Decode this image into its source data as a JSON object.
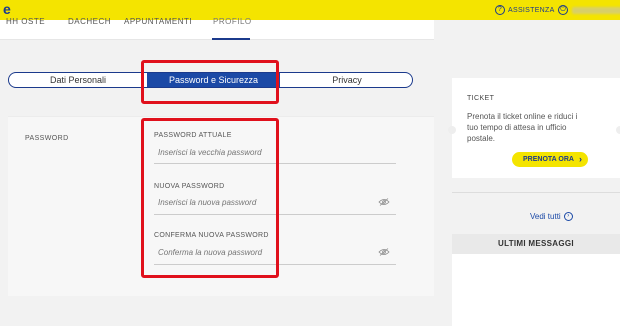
{
  "header": {
    "brand": "e",
    "assist_label": "ASSISTENZA",
    "help_icon": "question-circle-icon",
    "user_icon": "user-circle-icon"
  },
  "nav": {
    "items": [
      "HH OSTE",
      "DACHECH",
      "APPUNTAMENTI",
      "PROFILO"
    ],
    "active_index": 3
  },
  "tabs": {
    "items": [
      "Dati Personali",
      "Password e Sicurezza",
      "Privacy"
    ],
    "active_index": 1
  },
  "password_section": {
    "title": "PASSWORD",
    "fields": [
      {
        "label": "PASSWORD ATTUALE",
        "placeholder": "Inserisci la vecchia password",
        "value": "",
        "icon": ""
      },
      {
        "label": "NUOVA PASSWORD",
        "placeholder": "Inserisci la nuova password",
        "value": "",
        "icon": "eye-slash-icon"
      },
      {
        "label": "CONFERMA NUOVA PASSWORD",
        "placeholder": "Conferma la nuova password",
        "value": "",
        "icon": "eye-slash-icon"
      }
    ]
  },
  "ticket": {
    "title": "TICKET",
    "description": "Prenota il ticket online e riduci i tuo tempo di attesa in ufficio postale.",
    "button_label": "PRENOTA ORA",
    "button_icon": "chevron-right-icon"
  },
  "messages": {
    "view_all": "Vedi tutti",
    "view_all_icon": "arrow-right-circle-icon",
    "header": "ULTIMI MESSAGGI"
  },
  "colors": {
    "brand_yellow": "#f4e400",
    "brand_blue": "#1b3a8c",
    "active_tab": "#1b49a6",
    "highlight_red": "#e0101c"
  }
}
